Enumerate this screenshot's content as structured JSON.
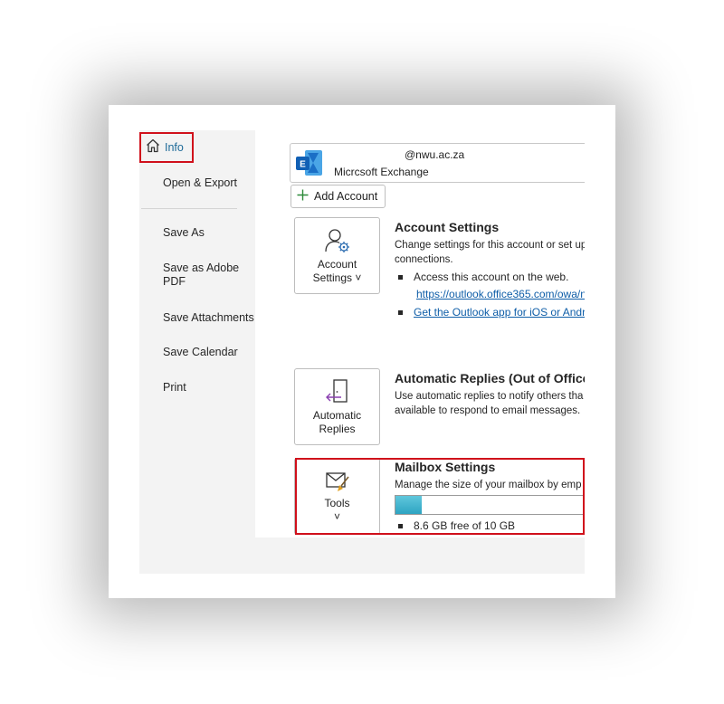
{
  "sidebar": {
    "active": "Info",
    "items": [
      "Open & Export",
      "Save As",
      "Save as Adobe PDF",
      "Save Attachments",
      "Save Calendar",
      "Print"
    ]
  },
  "account": {
    "email": "@nwu.ac.za",
    "type": "Micrcsoft Exchange",
    "add_label": "Add Account"
  },
  "account_settings": {
    "tile_line1": "Account",
    "tile_line2": "Settings ˅",
    "title": "Account Settings",
    "desc_line1": "Change settings for this account or set up",
    "desc_line2": "connections.",
    "bullet1": "Access this account on the web.",
    "link1": "https://outlook.office365.com/owa/n",
    "link2": "Get the Outlook app for iOS or Andr"
  },
  "auto_replies": {
    "tile_line1": "Automatic",
    "tile_line2": "Replies",
    "title": "Automatic Replies (Out of Office",
    "desc_line1": "Use automatic replies to notify others tha",
    "desc_line2": "available to respond to email messages."
  },
  "mailbox": {
    "tile_label": "Tools",
    "tile_chevron": "˅",
    "title": "Mailbox Settings",
    "desc": "Manage the size of your mailbox by emp",
    "usage_fraction": 0.14,
    "bullet": "8.6 GB free of 10 GB"
  },
  "colors": {
    "highlight": "#d0101b",
    "link": "#0f5ea8",
    "exchange_blue": "#1a73c8",
    "progress": "#2ea4c2"
  }
}
